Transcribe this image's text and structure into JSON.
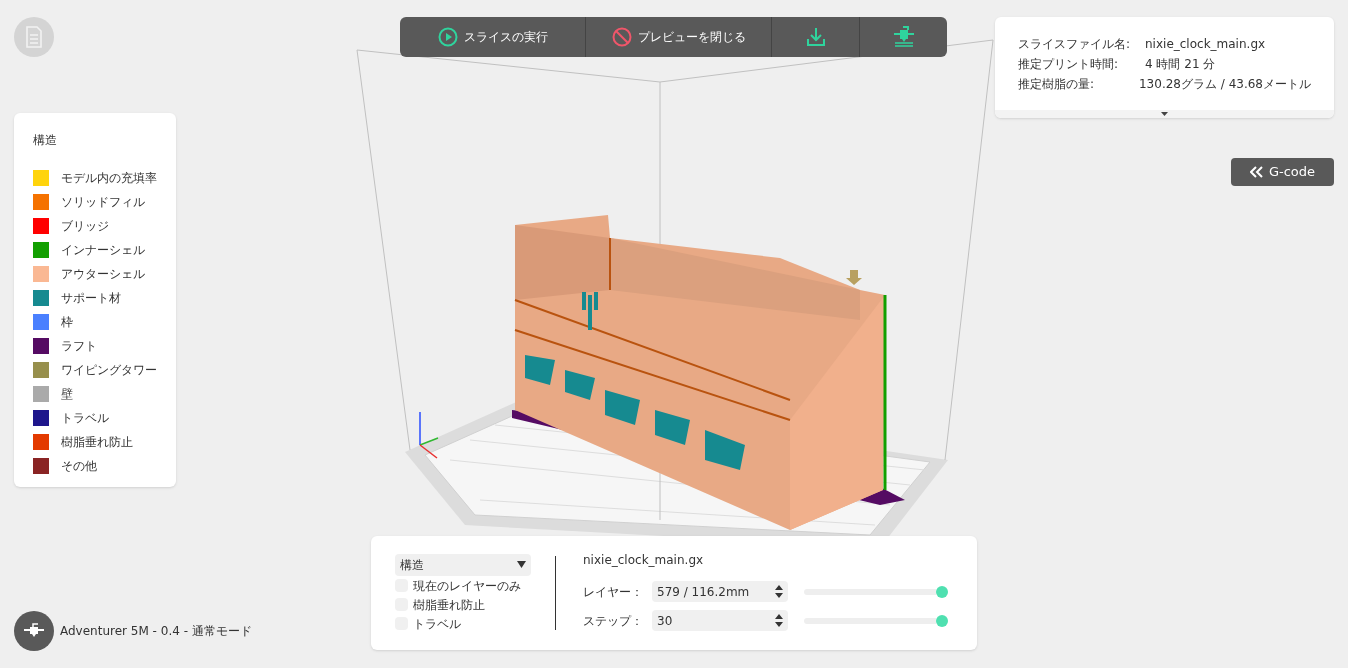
{
  "toolbar": {
    "buttons": [
      {
        "kind": "play",
        "label": "スライスの実行"
      },
      {
        "kind": "close",
        "label": "プレビューを閉じる"
      },
      {
        "kind": "download"
      },
      {
        "kind": "print"
      }
    ]
  },
  "info": {
    "rows": [
      {
        "label": "スライスファイル名:",
        "value": "nixie_clock_main.gx"
      },
      {
        "label": "推定プリント時間:",
        "value": "4 時間 21 分"
      },
      {
        "label": "推定樹脂の量:",
        "value": "130.28グラム / 43.68メートル"
      }
    ]
  },
  "gcode_button": "G-code",
  "legend": {
    "title": "構造",
    "items": [
      {
        "label": "モデル内の充填率",
        "color": "#ffd40c"
      },
      {
        "label": "ソリッドフィル",
        "color": "#f57200"
      },
      {
        "label": "ブリッジ",
        "color": "#ff0000"
      },
      {
        "label": "インナーシェル",
        "color": "#129f00"
      },
      {
        "label": "アウターシェル",
        "color": "#fab893"
      },
      {
        "label": "サポート材",
        "color": "#168a90"
      },
      {
        "label": "枠",
        "color": "#4a80ff"
      },
      {
        "label": "ラフト",
        "color": "#550b63"
      },
      {
        "label": "ワイピングタワー",
        "color": "#978f4c"
      },
      {
        "label": "壁",
        "color": "#aaaaaa"
      },
      {
        "label": "トラベル",
        "color": "#1e168c"
      },
      {
        "label": "樹脂垂れ防止",
        "color": "#e33a00"
      },
      {
        "label": "その他",
        "color": "#8a2424"
      }
    ]
  },
  "controls": {
    "view_select": "構造",
    "checkboxes": [
      {
        "label": "現在のレイヤーのみ",
        "checked": false
      },
      {
        "label": "樹脂垂れ防止",
        "checked": false
      },
      {
        "label": "トラベル",
        "checked": false
      }
    ],
    "filename": "nixie_clock_main.gx",
    "sliders": [
      {
        "label": "レイヤー：",
        "value": "579 / 116.2mm",
        "level": 1
      },
      {
        "label": "ステップ：",
        "value": "30",
        "level": 1
      }
    ]
  },
  "printer": "Adventurer 5M - 0.4 - 通常モード"
}
